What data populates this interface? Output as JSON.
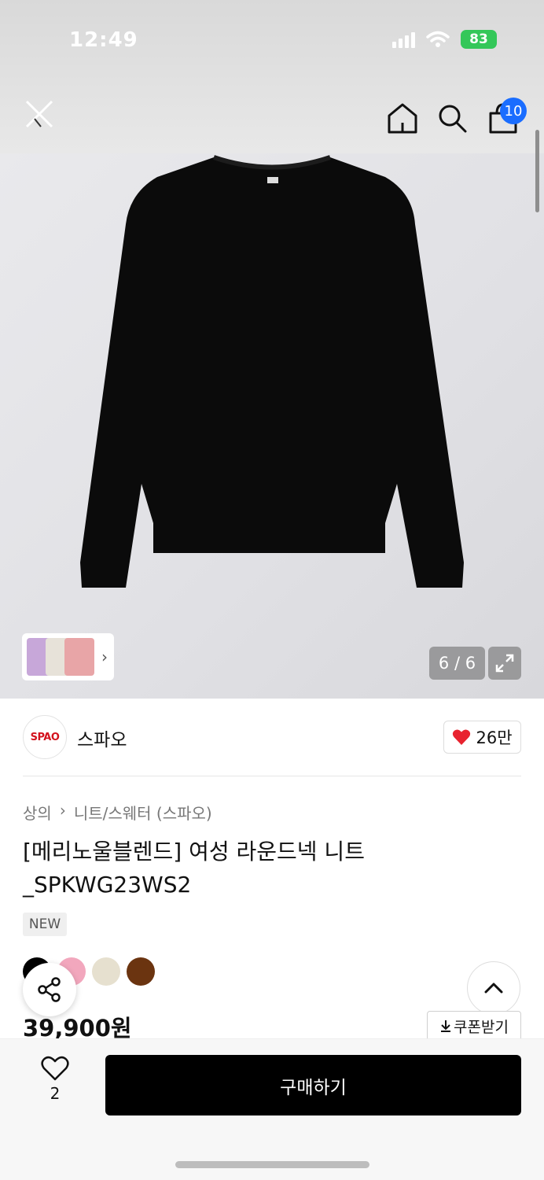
{
  "status": {
    "time": "12:49",
    "battery": "83"
  },
  "nav": {
    "cart_count": "10"
  },
  "gallery": {
    "page_counter": "6 / 6",
    "thumbnail_colors": [
      "#c7a7d9",
      "#e7e2d9",
      "#e8a5a7"
    ]
  },
  "brand": {
    "logo_text": "SPAO",
    "name": "스파오",
    "like_count": "26만"
  },
  "product": {
    "breadcrumb": [
      "상의",
      "니트/스웨터 (스파오)"
    ],
    "title": "[메리노울블렌드] 여성 라운드넥 니트_SPKWG23WS2",
    "tag": "NEW",
    "price": "39,900원",
    "swatch_colors": [
      "#000000",
      "#f2a7bd",
      "#e6e0cf",
      "#6b3410"
    ],
    "coupon_label": "쿠폰받기"
  },
  "bottom": {
    "favorite_count": "2",
    "buy_label": "구매하기"
  },
  "colors": {
    "accent_blue": "#1a6dff",
    "buy_button": "#000000",
    "brand_red": "#d3121d",
    "heart_red": "#e8232f"
  }
}
